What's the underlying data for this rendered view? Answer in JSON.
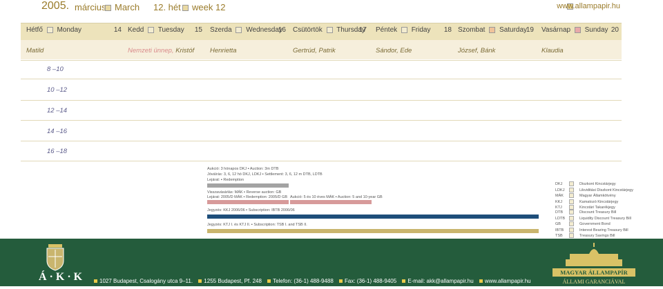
{
  "header": {
    "year": "2005.",
    "month_hu": "március",
    "month_en": "March",
    "week_hu": "12. hét",
    "week_en": "week 12",
    "website": "www.allampapir.hu"
  },
  "days": [
    {
      "hu": "Hétfő",
      "en": "Monday",
      "num": "14"
    },
    {
      "hu": "Kedd",
      "en": "Tuesday",
      "num": "15"
    },
    {
      "hu": "Szerda",
      "en": "Wednesday",
      "num": "16"
    },
    {
      "hu": "Csütörtök",
      "en": "Thursday",
      "num": "17"
    },
    {
      "hu": "Péntek",
      "en": "Friday",
      "num": "18"
    },
    {
      "hu": "Szombat",
      "en": "Saturday",
      "num": "19"
    },
    {
      "hu": "Vasárnap",
      "en": "Sunday",
      "num": "20"
    }
  ],
  "namedays": {
    "mon": "Matild",
    "tue_holiday": "Nemzeti ünnep,",
    "tue_name": "Kristóf",
    "wed": "Henrietta",
    "thu": "Gertrúd, Patrik",
    "fri": "Sándor, Ede",
    "sat": "József, Bánk",
    "sun": "Klaudia"
  },
  "time_slots": [
    "8 –10",
    "10 –12",
    "12 –14",
    "14 –16",
    "16 –18"
  ],
  "events": {
    "auction1_a": "Aukció: 3 hónapos DKJ",
    "auction1_b": "Auction: 3m DTB",
    "settle_a": "Jóváírás: 3, 6, 12 hó DKJ, LDKJ",
    "settle_b": "Settlement: 3, 6, 12 m DTB, LDTB",
    "redeem1_a": "Lejárat:",
    "redeem1_b": "Redemption",
    "reverse_a": "Visszavásárlás: MÁK",
    "reverse_b": "Reverse auction: GB",
    "redeem2_a": "Lejárat: 2005/D MÁK",
    "redeem2_b": "Redemption: 2005/D GB",
    "auction2_a": "Aukció: 5 és 10 éves MÁK",
    "auction2_b": "Auction: 5 and 10-year GB",
    "subscr1_a": "Jegyzés: KKJ 2006/06",
    "subscr1_b": "Subscription: IBTB 2006/06",
    "subscr2_a": "Jegyzés: KTJ I. és KTJ II.",
    "subscr2_b": "Subscription: TSB I. and TSB II."
  },
  "abbreviations_hu": [
    {
      "k": "DKJ",
      "v": "Diszkont Kincstárjegy"
    },
    {
      "k": "LDKJ",
      "v": "Likviditási Diszkont Kincstárjegy"
    },
    {
      "k": "MÁK",
      "v": "Magyar Államkötvény"
    },
    {
      "k": "KKJ",
      "v": "Kamatozó Kincstárjegy"
    },
    {
      "k": "KTJ",
      "v": "Kincstári Takarékjegy"
    }
  ],
  "abbreviations_en": [
    {
      "k": "DTB",
      "v": "Discount Treasury Bill"
    },
    {
      "k": "LDTB",
      "v": "Liquidity Discount Treasury Bill"
    },
    {
      "k": "GB",
      "v": "Government Bond"
    },
    {
      "k": "IBTB",
      "v": "Interest Bearing Treasury Bill"
    },
    {
      "k": "TSB",
      "v": "Treasury Savings Bill"
    }
  ],
  "footer": {
    "logo_text": "Á · K · K",
    "addr1": "1027 Budapest, Csalogány utca 9–11.",
    "addr2": "1255 Budapest, Pf. 248",
    "phone": "Telefon: (36-1) 488-9488",
    "fax": "Fax: (36-1) 488-9405",
    "email": "E-mail: akk@allampapir.hu",
    "web": "www.allampapir.hu",
    "brand": "MAGYAR ÁLLAMPAPÍR",
    "tagline": "ÁLLAMI GARANCIÁVAL"
  },
  "colors": {
    "gold": "#9a7b2a",
    "header_bar": "#ede3bb",
    "grey_bar": "#a3a3a3",
    "pink_bar": "#d79a9a",
    "blue_bar": "#1e4e7a",
    "tan_bar": "#c9b56e",
    "footer_green": "#245c3c"
  }
}
